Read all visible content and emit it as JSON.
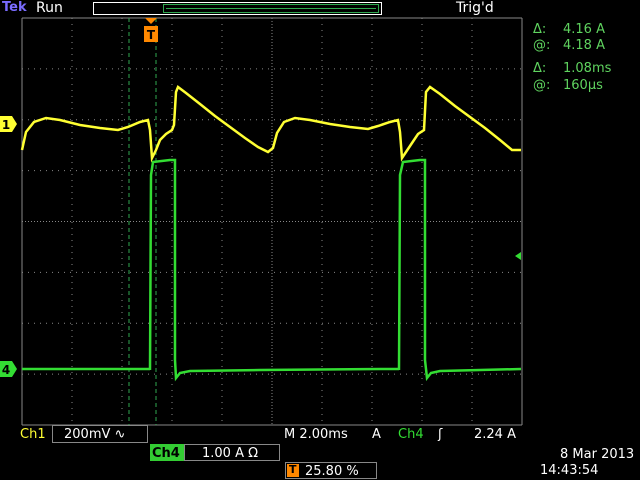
{
  "header": {
    "brand": "Tek",
    "run_state": "Run",
    "trigger_state": "Trig'd"
  },
  "trigger_marker": "T",
  "measurements": [
    {
      "symbol": "Δ:",
      "value": "4.16 A"
    },
    {
      "symbol": "@:",
      "value": "4.18 A"
    },
    {
      "symbol": "Δ:",
      "value": "1.08ms"
    },
    {
      "symbol": "@:",
      "value": "160µs"
    }
  ],
  "channels": {
    "ch1": {
      "marker": "1",
      "label": "Ch1",
      "scale": "200mV",
      "coupling_icon": "ac-coupling-icon",
      "coupling_glyph": "∿",
      "color": "#ffff33"
    },
    "ch4": {
      "marker": "4",
      "label": "Ch4",
      "scale": "1.00 A Ω",
      "color": "#33dd33"
    }
  },
  "timebase": "M 2.00ms",
  "trigger": {
    "source_prefix": "A",
    "channel": "Ch4",
    "slope_icon": "rising-edge-icon",
    "slope_glyph": "ʃ",
    "level": "2.24 A"
  },
  "trigger_position": {
    "icon": "T",
    "value": "25.80 %"
  },
  "datetime": {
    "date": "8 Mar 2013",
    "time": "14:43:54"
  },
  "colors": {
    "ch1": "#ffff33",
    "ch4": "#33dd33",
    "grid": "#888888",
    "cursor": "#2fa84f",
    "trigger": "#ff8800"
  }
}
